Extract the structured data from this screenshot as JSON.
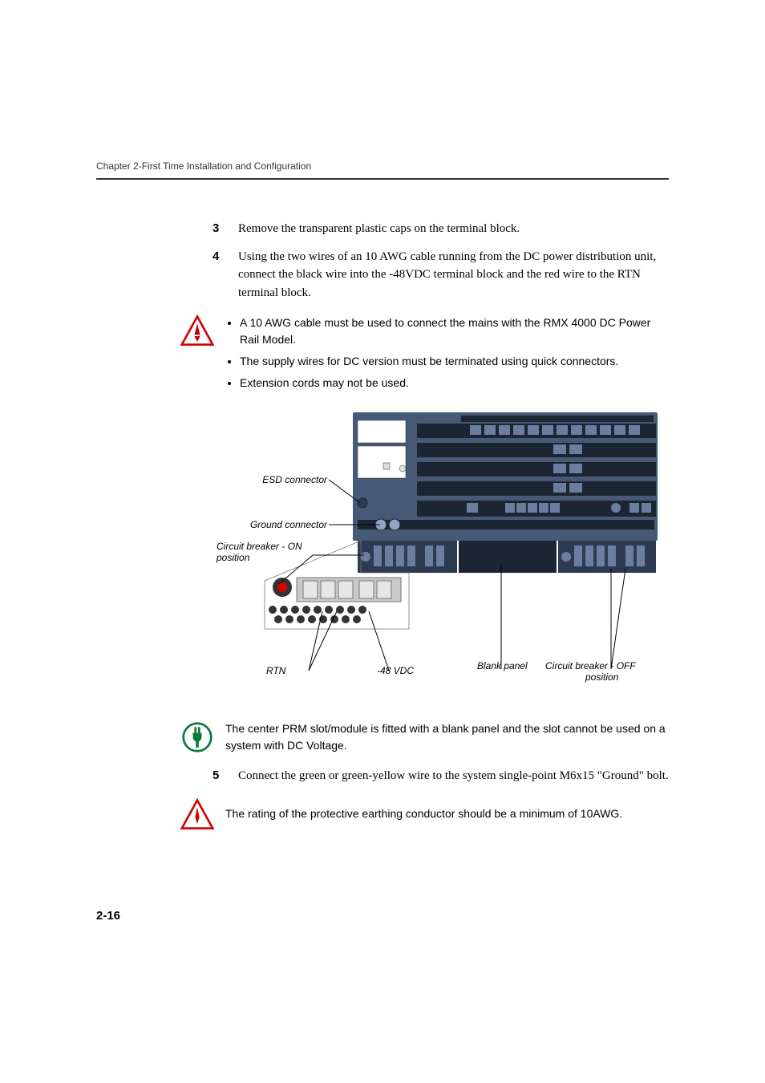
{
  "header": {
    "chapter": "Chapter 2-First Time Installation and Configuration"
  },
  "steps": {
    "s3": {
      "num": "3",
      "text": "Remove the transparent plastic caps on the terminal block."
    },
    "s4": {
      "num": "4",
      "text": "Using the two wires of an 10 AWG cable running from the DC power distribution unit, connect the black wire into the -48VDC terminal block and the red wire to the RTN terminal block."
    },
    "s5": {
      "num": "5",
      "text": "Connect the green or green-yellow wire to the system single-point M6x15 \"Ground\" bolt."
    }
  },
  "warning1": {
    "bullets": [
      "A 10 AWG cable must be used to connect the mains with the RMX 4000 DC Power Rail Model.",
      "The supply wires for DC version must be terminated using quick connectors.",
      "Extension cords may not be used."
    ]
  },
  "note_center": "The center PRM slot/module is fitted with a blank panel and the slot cannot be used on a system with DC Voltage.",
  "warning2": "The rating of the protective earthing conductor should be a minimum of 10AWG.",
  "diagram": {
    "labels": {
      "esd": "ESD connector",
      "ground": "Ground connector",
      "breaker_on": "Circuit breaker - ON position",
      "rtn": "RTN",
      "vdc": "-48 VDC",
      "blank": "Blank panel",
      "breaker_off": "Circuit breaker - OFF position"
    }
  },
  "footer": {
    "page": "2-16"
  }
}
